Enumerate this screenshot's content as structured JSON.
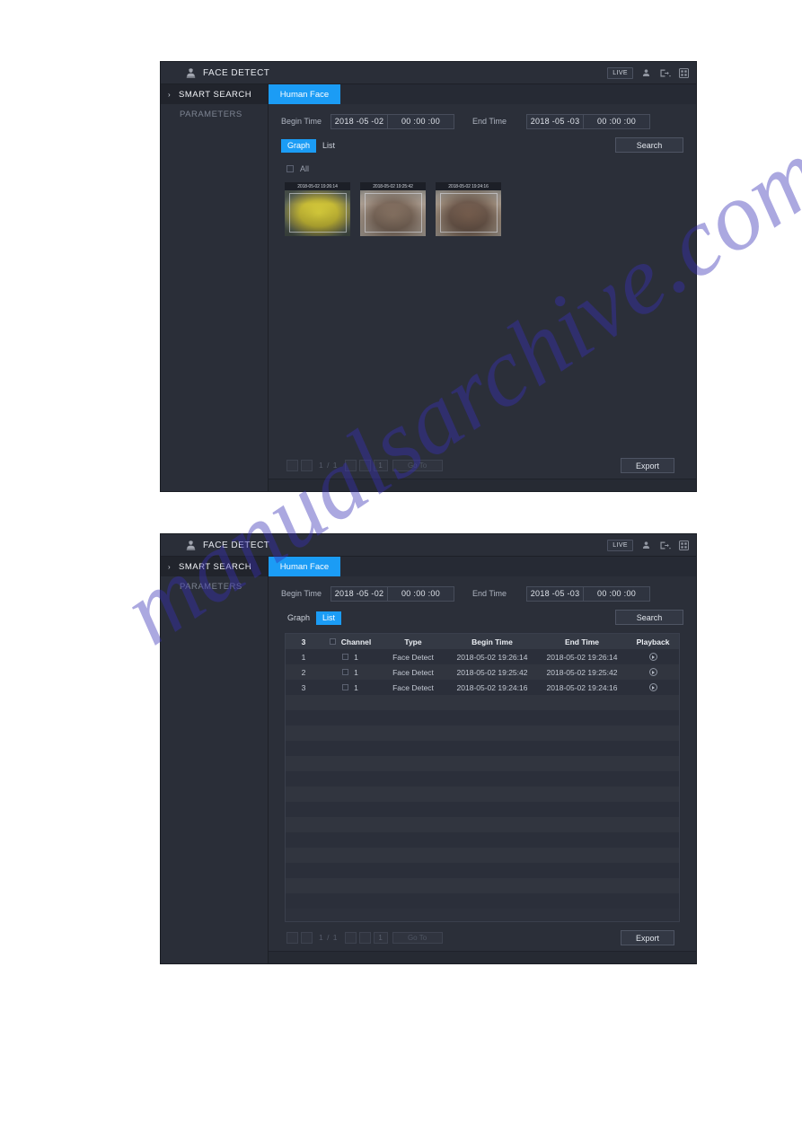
{
  "window": {
    "title": "FACE DETECT",
    "title_icon": "face-detect-icon",
    "live_badge": "LIVE",
    "header_icons": [
      "user-icon",
      "logout-icon",
      "grid-icon"
    ]
  },
  "sidebar": {
    "items": [
      {
        "label": "SMART SEARCH",
        "active": true,
        "chevron": "›"
      },
      {
        "label": "PARAMETERS",
        "active": false
      }
    ]
  },
  "tabs": [
    {
      "label": "Human Face",
      "active": true
    }
  ],
  "form": {
    "begin_label": "Begin Time",
    "begin_date": "2018 -05 -02",
    "begin_time": "00 :00 :00",
    "end_label": "End Time",
    "end_date": "2018 -05 -03",
    "end_time": "00 :00 :00"
  },
  "view_toggle": {
    "graph": "Graph",
    "list": "List"
  },
  "buttons": {
    "search": "Search",
    "export": "Export"
  },
  "graph_panel": {
    "active_view": "Graph",
    "all_checkbox_label": "All",
    "thumbnails": [
      {
        "timestamp": "2018-05-02 19:26:14",
        "face": "face-a"
      },
      {
        "timestamp": "2018-05-02 19:25:42",
        "face": "face-b"
      },
      {
        "timestamp": "2018-05-02 19:24:16",
        "face": "face-c"
      }
    ]
  },
  "list_panel": {
    "active_view": "List",
    "table": {
      "headers": {
        "count": "3",
        "channel": "Channel",
        "type": "Type",
        "begin_time": "Begin Time",
        "end_time": "End Time",
        "playback": "Playback"
      },
      "rows": [
        {
          "no": "1",
          "channel": "1",
          "type": "Face Detect",
          "begin": "2018-05-02 19:26:14",
          "end": "2018-05-02 19:26:14",
          "playback": "play-icon"
        },
        {
          "no": "2",
          "channel": "1",
          "type": "Face Detect",
          "begin": "2018-05-02 19:25:42",
          "end": "2018-05-02 19:25:42",
          "playback": "play-icon"
        },
        {
          "no": "3",
          "channel": "1",
          "type": "Face Detect",
          "begin": "2018-05-02 19:24:16",
          "end": "2018-05-02 19:24:16",
          "playback": "play-icon"
        }
      ]
    }
  },
  "pagination": {
    "page_indicator": "1 / 1",
    "page_input": "1",
    "goto_label": "Go To"
  },
  "watermark": {
    "text": "manualsarchive.com"
  },
  "colors": {
    "accent_blue": "#1b9cf5",
    "window_bg": "#2b2f39",
    "sidebar_bg": "#2a2e38",
    "titlebar_bg": "#2a2e38",
    "text_primary": "#e6e9ef",
    "text_dim": "#7d8492",
    "watermark_blue": "#362fb4"
  }
}
